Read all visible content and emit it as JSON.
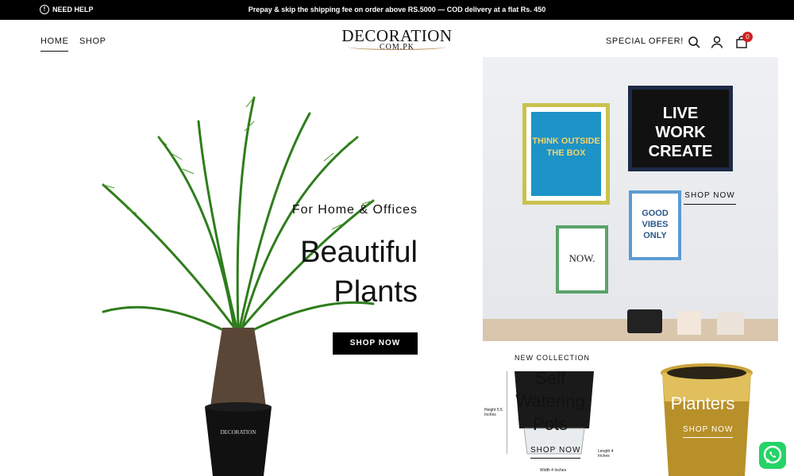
{
  "topbar": {
    "help_label": "NEED HELP",
    "promo_text": "Prepay & skip the shipping fee on order above RS.5000 — COD delivery at a flat Rs. 450"
  },
  "nav": {
    "home": "HOME",
    "shop": "SHOP",
    "logo_main": "DECORATION",
    "logo_sub": "COM.PK",
    "special": "SPECIAL OFFER!",
    "cart_count": "0"
  },
  "hero": {
    "subtitle": "For Home & Offices",
    "title_line1": "Beautiful",
    "title_line2": "Plants",
    "button": "SHOP NOW",
    "pot_brand": "DECORATION"
  },
  "card_frames": {
    "button": "SHOP NOW",
    "frame1": "THINK OUTSIDE THE BOX",
    "frame2": "LIVE WORK CREATE",
    "frame3": "GOOD VIBES ONLY",
    "frame4": "NOW."
  },
  "card_pots": {
    "label": "NEW COLLECTION",
    "title": [
      "Self",
      "Watering",
      "Pots"
    ],
    "button": "SHOP NOW",
    "dim_height": "Height 5.5 Inches",
    "dim_length": "Length 4 Inches",
    "dim_width": "Width 4 Inches"
  },
  "card_planters": {
    "title": "Planters",
    "button": "SHOP NOW"
  },
  "colors": {
    "topbar": "#000000",
    "accent": "#b28b54",
    "badge": "#d31e1e",
    "whatsapp": "#25d366"
  }
}
